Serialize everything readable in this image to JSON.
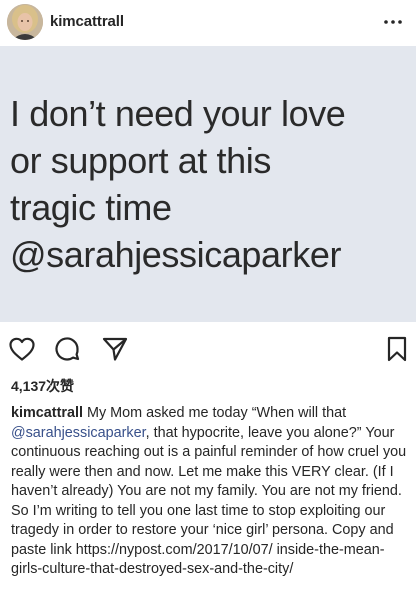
{
  "header": {
    "username": "kimcattrall",
    "more_icon": "more-horizontal-icon"
  },
  "image": {
    "background_color": "#e3e7ee",
    "quote": "I don’t need your love\nor support at this\ntragic time\n@sarahjessicaparker"
  },
  "actions": {
    "like_icon": "heart-icon",
    "comment_icon": "comment-icon",
    "share_icon": "share-icon",
    "save_icon": "bookmark-icon"
  },
  "likes": "4,137次赞",
  "caption": {
    "username": "kimcattrall",
    "part1": " My Mom asked me today “When will that ",
    "mention": "@sarahjessicaparker",
    "part2": ", that hypocrite, leave you alone?” Your continuous reaching out is a painful reminder of how cruel you really were then and now. Let me make this VERY clear. (If I haven’t already) You are not my family. You are not my friend. So I’m writing to tell you one last time to stop exploiting our tragedy in order to restore your ‘nice girl’ persona. Copy and paste link https://nypost.com/2017/10/07/ inside-the-mean-girls-culture-that-destroyed-sex-and-the-city/"
  },
  "colors": {
    "text": "#262626",
    "mention": "#38508a",
    "image_bg": "#e3e7ee"
  }
}
